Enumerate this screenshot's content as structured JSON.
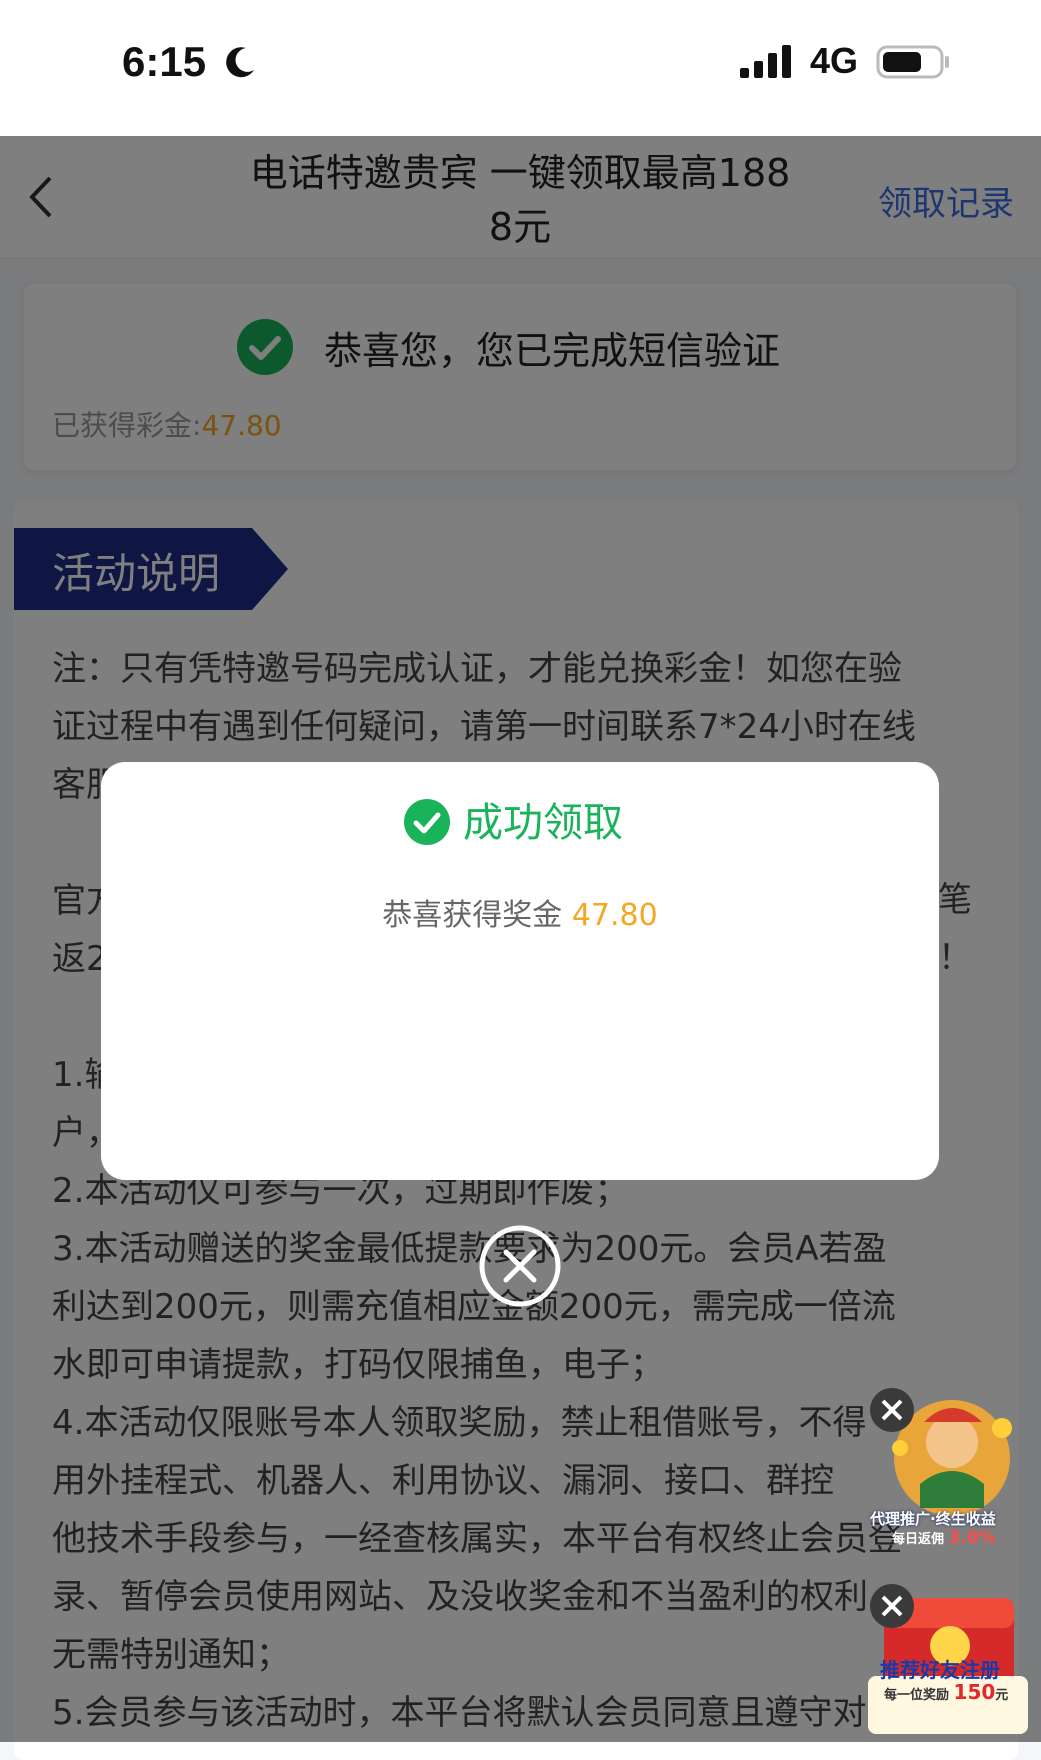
{
  "status_bar": {
    "time": "6:15",
    "network": "4G",
    "icons": [
      "moon-icon",
      "signal-icon",
      "battery-icon"
    ]
  },
  "navbar": {
    "title": "电话特邀贵宾 一键领取最高1888元",
    "title_line1": "电话特邀贵宾 一键领取最高188",
    "title_line2": "8元",
    "record_link": "领取记录"
  },
  "verify_card": {
    "message": "恭喜您，您已完成短信验证",
    "bonus_label": "已获得彩金:",
    "bonus_amount": "47.80"
  },
  "activity": {
    "tag_label": "活动说明",
    "lines": [
      "注：只有凭特邀号码完成认证，才能兑换彩金！如您在验",
      "证过程中有遇到任何疑问，请第一时间联系7*24小时在线",
      "客服",
      "",
      "官方",
      "返2",
      "",
      "1.输",
      "户，",
      "2.本活动仅可参与一次，过期即作废；",
      "3.本活动赠送的奖金最低提款要求为200元。会员A若盈",
      "利达到200元，则需充值相应金额200元，需完成一倍流",
      "水即可申请提款，打码仅限捕鱼，电子；",
      "4.本活动仅限账号本人领取奖励，禁止租借账号，不得",
      "用外挂程式、机器人、利用协议、漏洞、接口、群控",
      "他技术手段参与，一经查核属实，本平台有权终止会员登",
      "录、暂停会员使用网站、及没收奖金和不当盈利的权利",
      "无需特别通知；",
      "5.会员参与该活动时，本平台将默认会员同意且遵守对于"
    ],
    "right_fragments": [
      "笔",
      "！"
    ]
  },
  "modal": {
    "title": "成功领取",
    "text_label": "恭喜获得奖金",
    "amount": "47.80"
  },
  "floating_ads": {
    "ad1_line1": "代理推广·终生收益",
    "ad1_line2": "每日返佣",
    "ad1_rate": "3.0%",
    "ad2_line1": "推荐好友注册",
    "ad2_line2": "每一位奖励",
    "ad2_amount": "150",
    "ad2_unit": "元"
  },
  "colors": {
    "success_green": "#19b35a",
    "bonus_orange": "#f5a623",
    "link_blue": "#3a6be0",
    "tag_navy": "#1f2d86"
  }
}
